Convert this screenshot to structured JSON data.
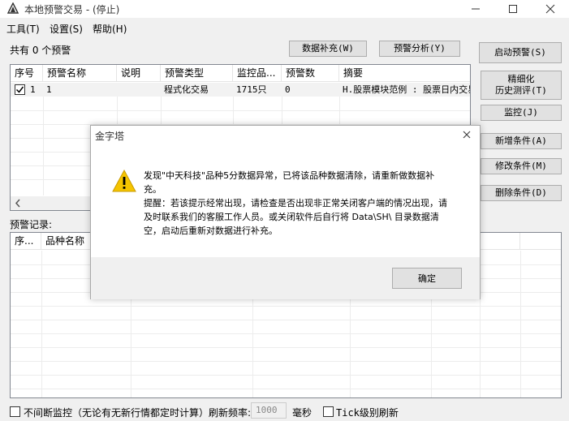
{
  "window": {
    "title": "本地预警交易 - (停止)",
    "minimize_glyph": "—",
    "maximize_glyph": "☐",
    "close_glyph": "✕"
  },
  "menu": [
    "工具(T)",
    "设置(S)",
    "帮助(H)"
  ],
  "alerts": {
    "count_label": "共有 0 个预警",
    "btn_supplement": "数据补充(W)",
    "btn_analysis": "预警分析(Y)",
    "columns": [
      "序号",
      "预警名称",
      "说明",
      "预警类型",
      "监控品...",
      "预警数",
      "摘要"
    ],
    "rows": [
      {
        "checked": true,
        "index": "1",
        "name": "1",
        "desc": "",
        "type": "程式化交易",
        "monitored": "1715只",
        "alert_count": "0",
        "summary": "H.股票模块范例 : 股票日内交易"
      }
    ]
  },
  "side_buttons": {
    "start": "启动预警(S)",
    "refine_line1": "精细化",
    "refine_line2": "历史测评(T)",
    "monitor": "监控(J)",
    "add": "新增条件(A)",
    "modify": "修改条件(M)",
    "delete": "删除条件(D)"
  },
  "records": {
    "label": "预警记录:",
    "columns": [
      "序...",
      "品种名称"
    ]
  },
  "footer": {
    "continuous_label": "不间断监控（无论有无新行情都定时计算）刷新频率:",
    "refresh_value": "1000",
    "unit": "毫秒",
    "tick_label": "Tick级别刷新"
  },
  "dialog": {
    "title": "金字塔",
    "message_line1": "发现\"中天科技\"品种5分数据异常，已将该品种数据清除，请重新做数据补",
    "message_line2": "充。",
    "message_line3": "提醒：若该提示经常出现，请检查是否出现非正常关闭客户端的情况出现，请",
    "message_line4": "及时联系我们的客服工作人员。或关闭软件后自行将 Data\\SH\\ 目录数据清",
    "message_line5": "空，启动后重新对数据进行补充。",
    "ok_label": "确定",
    "warning_icon": "warning-icon",
    "warning_color": "#f5c400"
  }
}
